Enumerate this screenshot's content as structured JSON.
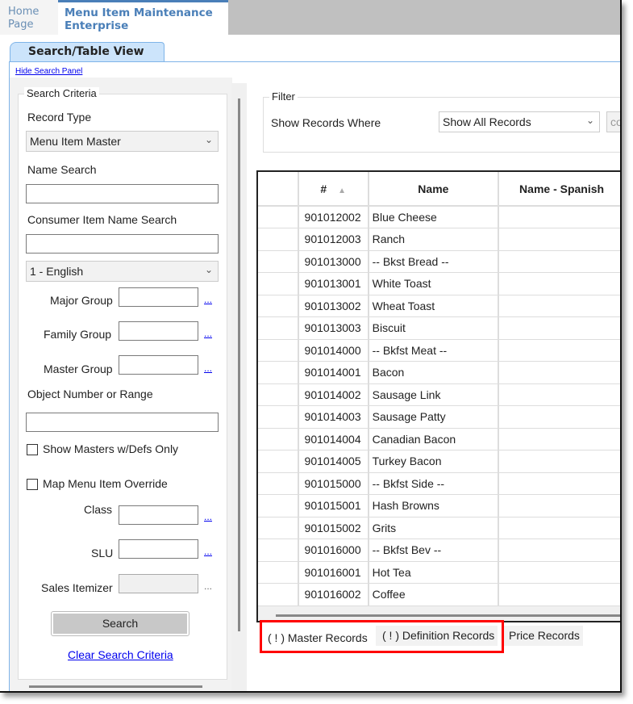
{
  "tabs": {
    "home": "Home Page",
    "home_l1": "Home",
    "home_l2": "Page",
    "active_l1": "Menu Item Maintenance",
    "active_l2": "Enterprise"
  },
  "subtab": "Search/Table View",
  "hide_panel": "Hide Search Panel",
  "search": {
    "legend": "Search Criteria",
    "record_type_label": "Record Type",
    "record_type": "Menu Item Master",
    "name_search": "Name Search",
    "consumer_search": "Consumer Item Name Search",
    "language": "1 - English",
    "major_group": "Major Group",
    "family_group": "Family Group",
    "master_group": "Master Group",
    "object_number": "Object Number or Range",
    "show_masters": "Show Masters w/Defs Only",
    "map_override": "Map Menu Item Override",
    "class": "Class",
    "slu": "SLU",
    "sales_itemizer": "Sales Itemizer",
    "ellipsis": "...",
    "search_button": "Search",
    "clear": "Clear Search Criteria"
  },
  "filter": {
    "legend": "Filter",
    "label": "Show Records Where",
    "value": "Show All Records",
    "extra": "co"
  },
  "grid": {
    "columns": [
      "#",
      "Name",
      "Name - Spanish"
    ],
    "rows": [
      [
        "901012002",
        "Blue Cheese"
      ],
      [
        "901012003",
        "Ranch"
      ],
      [
        "901013000",
        "-- Bkst Bread --"
      ],
      [
        "901013001",
        "White Toast"
      ],
      [
        "901013002",
        "Wheat Toast"
      ],
      [
        "901013003",
        "Biscuit"
      ],
      [
        "901014000",
        "-- Bkfst Meat --"
      ],
      [
        "901014001",
        "Bacon"
      ],
      [
        "901014002",
        "Sausage Link"
      ],
      [
        "901014003",
        "Sausage Patty"
      ],
      [
        "901014004",
        "Canadian Bacon"
      ],
      [
        "901014005",
        "Turkey Bacon"
      ],
      [
        "901015000",
        "-- Bkfst Side --"
      ],
      [
        "901015001",
        "Hash Browns"
      ],
      [
        "901015002",
        "Grits"
      ],
      [
        "901016000",
        "-- Bkfst Bev --"
      ],
      [
        "901016001",
        "Hot Tea"
      ],
      [
        "901016002",
        "Coffee"
      ]
    ]
  },
  "bottom_tabs": [
    "( ! ) Master Records",
    "( ! ) Definition Records",
    "Price Records"
  ],
  "colors": {
    "accent": "#4a7fb8",
    "highlight": "#ff0000"
  }
}
